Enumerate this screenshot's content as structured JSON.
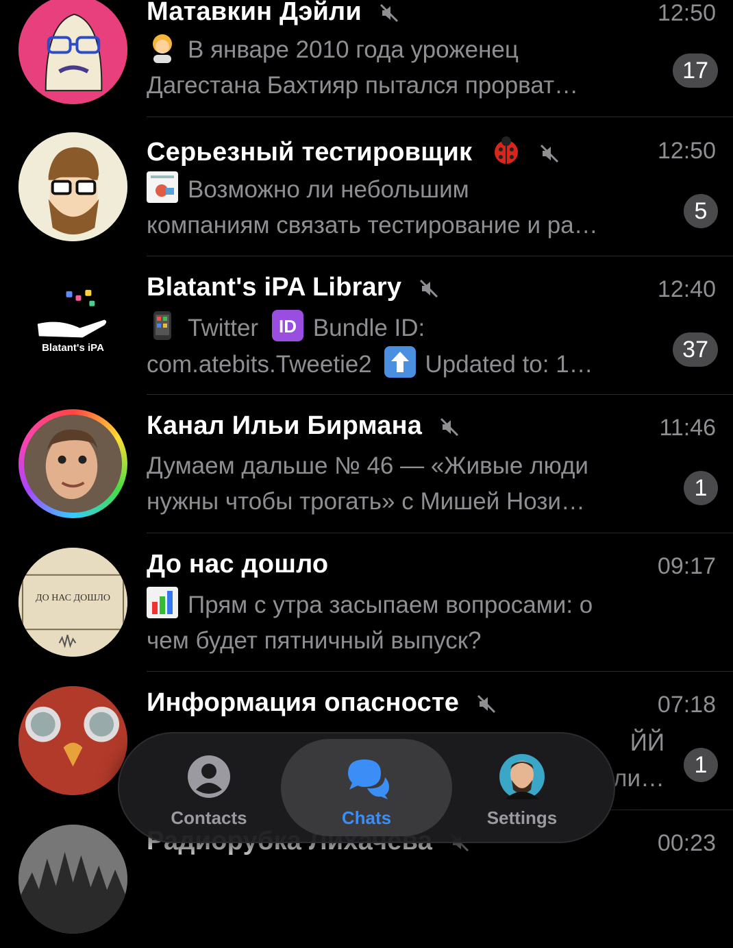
{
  "chats": [
    {
      "title": "Матавкин Дэйли",
      "time": "12:50",
      "line1": "В январе 2010 года уроженец",
      "line2": "Дагестана Бахтияр пытался прорват…",
      "badge": "17",
      "muted": true,
      "emoji": "person-emoji"
    },
    {
      "title": "Серьезный тестировщик",
      "time": "12:50",
      "line1": "Возможно ли небольшим",
      "line2": "компаниям связать тестирование и ра…",
      "badge": "5",
      "muted": true,
      "emoji": "image-thumbnail"
    },
    {
      "title": "Blatant's iPA Library",
      "time": "12:40",
      "line1": "Twitter",
      "line1b": "Bundle ID:",
      "line2a": "com.atebits.Tweetie2",
      "line2b": "Updated to: 1…",
      "badge": "37",
      "muted": true,
      "emoji": "phone-emoji"
    },
    {
      "title": "Канал Ильи Бирмана",
      "time": "11:46",
      "line1": "Думаем дальше № 46 — «Живые люди",
      "line2": "нужны чтобы трогать» с Мишей Нози…",
      "badge": "1",
      "muted": true
    },
    {
      "title": "До нас дошло",
      "time": "09:17",
      "line1": "Прям с утра засыпаем вопросами: о",
      "line2": "чем будет пятничный выпуск?",
      "muted": false,
      "emoji": "chart-emoji"
    },
    {
      "title": "Информация опасносте",
      "time": "07:18",
      "line1": "ЙЙ",
      "line2": "ли…",
      "badge": "1",
      "muted": true
    },
    {
      "title": "Радиорубка Лихачева",
      "time": "00:23",
      "line1": "",
      "muted": true
    }
  ],
  "avatars": {
    "blatant_text": "Blatant's iPA",
    "do_nas_doshlo_text": "ДО НАС ДОШЛО"
  },
  "tabbar": {
    "contacts": "Contacts",
    "chats": "Chats",
    "settings": "Settings"
  },
  "colors": {
    "accent": "#3a8ef6",
    "secondary": "#8e8e93",
    "badge": "#4a4a4c"
  }
}
